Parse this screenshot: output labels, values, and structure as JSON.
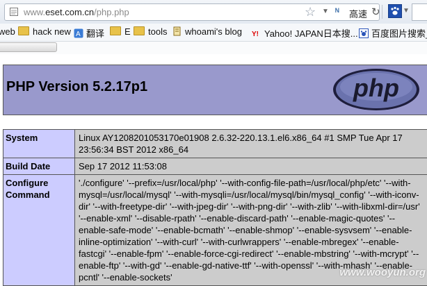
{
  "browser": {
    "url_muted": "www.",
    "url_host": "eset.com.cn",
    "url_path": "/php.php",
    "speed_label": "高速"
  },
  "bookmarks": [
    {
      "label": "web",
      "icon": "none"
    },
    {
      "label": "hack new",
      "icon": "folder"
    },
    {
      "label": "翻译",
      "icon": "translate"
    },
    {
      "label": "E",
      "icon": "folder"
    },
    {
      "label": "tools",
      "icon": "folder"
    },
    {
      "label": "whoami's blog",
      "icon": "bookmark"
    },
    {
      "label": "Yahoo! JAPAN日本搜...",
      "icon": "yahoo"
    },
    {
      "label": "百度图片搜索_",
      "icon": "baidu"
    }
  ],
  "php": {
    "title": "PHP Version 5.2.17p1",
    "logo_text": "php"
  },
  "info": {
    "rows": [
      {
        "key": "System",
        "value": "Linux AY1208201053170e01908 2.6.32-220.13.1.el6.x86_64 #1 SMP Tue Apr 17 23:56:34 BST 2012 x86_64"
      },
      {
        "key": "Build Date",
        "value": "Sep 17 2012 11:53:08"
      },
      {
        "key": "Configure Command",
        "value": "'./configure' '--prefix=/usr/local/php' '--with-config-file-path=/usr/local/php/etc' '--with-mysql=/usr/local/mysql' '--with-mysqli=/usr/local/mysql/bin/mysql_config' '--with-iconv-dir' '--with-freetype-dir' '--with-jpeg-dir' '--with-png-dir' '--with-zlib' '--with-libxml-dir=/usr' '--enable-xml' '--disable-rpath' '--enable-discard-path' '--enable-magic-quotes' '--enable-safe-mode' '--enable-bcmath' '--enable-shmop' '--enable-sysvsem' '--enable-inline-optimization' '--with-curl' '--with-curlwrappers' '--enable-mbregex' '--enable-fastcgi' '--enable-fpm' '--enable-force-cgi-redirect' '--enable-mbstring' '--with-mcrypt' '--enable-ftp' '--with-gd' '--enable-gd-native-ttf' '--with-openssl' '--with-mhash' '--enable-pcntl' '--enable-sockets'"
      }
    ]
  },
  "watermark": "www.wooyun.org",
  "colors": {
    "header_bg": "#9999cc",
    "key_bg": "#ccccff",
    "value_bg": "#cccccc"
  }
}
